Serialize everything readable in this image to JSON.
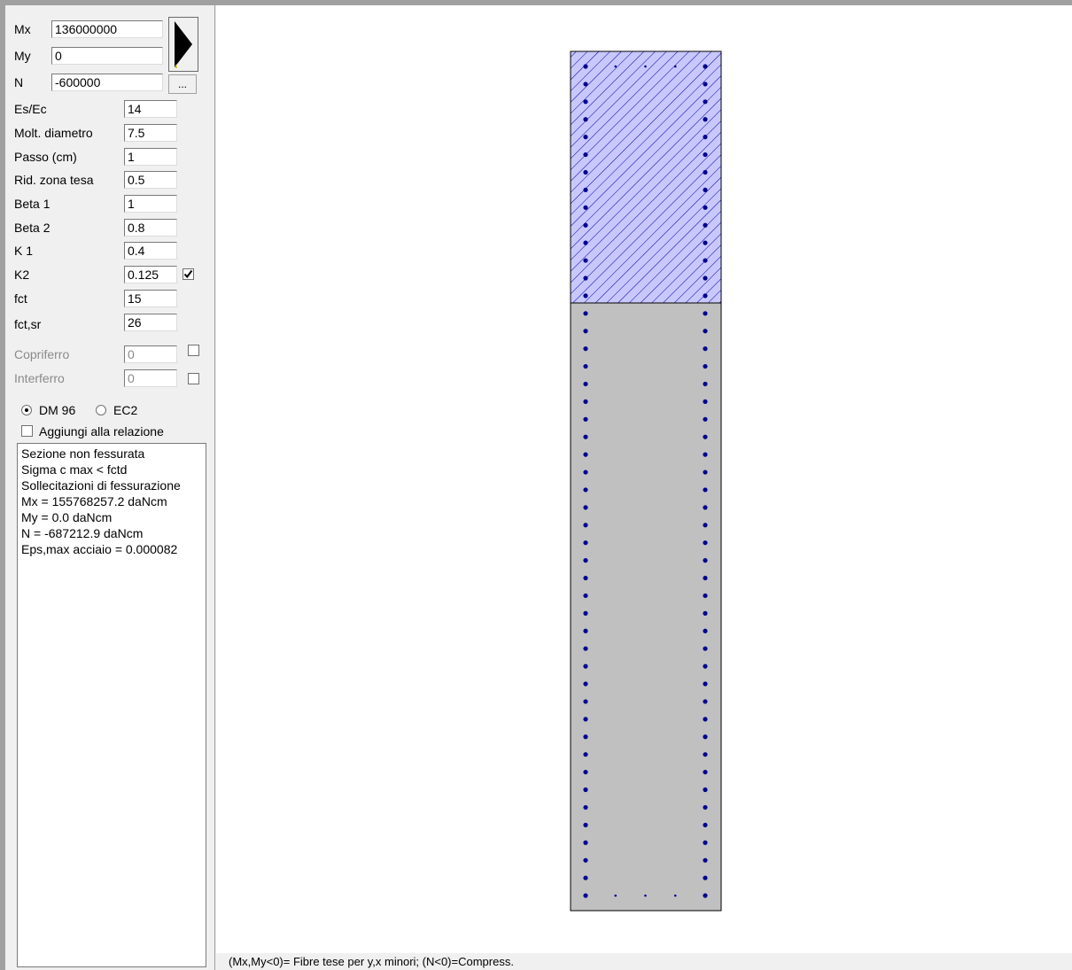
{
  "inputs": {
    "mx": {
      "label": "Mx",
      "value": "136000000"
    },
    "my": {
      "label": "My",
      "value": "0"
    },
    "n": {
      "label": "N",
      "value": "-600000"
    }
  },
  "dots_button_label": "...",
  "params": [
    {
      "label": "Es/Ec",
      "value": "14"
    },
    {
      "label": "Molt. diametro",
      "value": "7.5"
    },
    {
      "label": "Passo (cm)",
      "value": "1"
    },
    {
      "label": "Rid. zona tesa",
      "value": "0.5"
    },
    {
      "label": "Beta 1",
      "value": "1"
    },
    {
      "label": "Beta 2",
      "value": "0.8"
    },
    {
      "label": "K 1",
      "value": "0.4"
    },
    {
      "label": "K2",
      "value": "0.125",
      "checked": true
    },
    {
      "label": "fct",
      "value": "15"
    },
    {
      "label": "fct,sr",
      "value": "26"
    },
    {
      "label": "Copriferro",
      "value": "0",
      "disabled": true,
      "checked": false
    },
    {
      "label": "Interferro",
      "value": "0",
      "disabled": true,
      "checked": false
    }
  ],
  "norm": {
    "options": [
      "DM 96",
      "EC2"
    ],
    "selected": "DM 96"
  },
  "aggiungi": {
    "label": "Aggiungi alla relazione",
    "checked": false
  },
  "results": [
    "Sezione non fessurata",
    "Sigma c max < fctd",
    "Sollecitazioni di fessurazione",
    "Mx = 155768257.2 daNcm",
    "My = 0.0 daNcm",
    "N = -687212.9 daNcm",
    "Eps,max acciaio = 0.000082"
  ],
  "status_text": "(Mx,My<0)= Fibre tese per y,x minori; (N<0)=Compress.",
  "section": {
    "compressed_fraction": 0.293,
    "bar_rows": 48,
    "top_inner_bars": 3,
    "bottom_inner_bars": 3
  },
  "colors": {
    "section_fill": "#c0c0c0",
    "compressed_hatch_bg": "#c8c8ff",
    "hatch_lines": "#0000a0",
    "rebar": "#000090"
  },
  "icons": {
    "arrow_button": "right-arrow-icon",
    "check": "checkmark-icon"
  }
}
